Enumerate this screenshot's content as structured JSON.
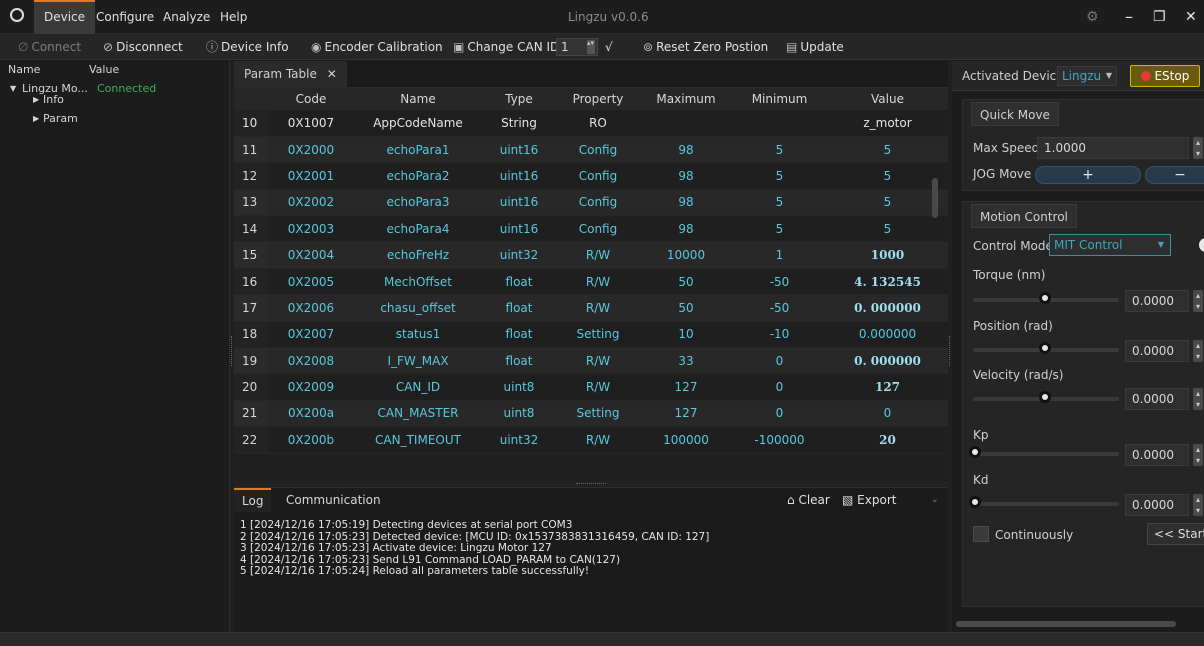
{
  "window": {
    "title": "Lingzu v0.0.6"
  },
  "menu": [
    "Device",
    "Configure",
    "Analyze",
    "Help"
  ],
  "toolbar": {
    "connect": "Connect",
    "disconnect": "Disconnect",
    "device_info": "Device Info",
    "encoder_calibration": "Encoder Calibration",
    "change_can_id": "Change CAN ID",
    "can_id_value": "1",
    "confirm": "√",
    "reset_zero": "Reset Zero Postion",
    "update": "Update"
  },
  "tree": {
    "headers": {
      "name": "Name",
      "value": "Value"
    },
    "device": {
      "name": "Lingzu Mo...",
      "value": "Connected"
    },
    "children": [
      "Info",
      "Param"
    ]
  },
  "param_tab": {
    "label": "Param Table",
    "close": "✕"
  },
  "table": {
    "columns": [
      "",
      "Code",
      "Name",
      "Type",
      "Property",
      "Maximum",
      "Minimum",
      "Value"
    ],
    "rows": [
      [
        "10",
        "0X1007",
        "AppCodeName",
        "String",
        "RO",
        "",
        "",
        "z_motor"
      ],
      [
        "11",
        "0X2000",
        "echoPara1",
        "uint16",
        "Config",
        "98",
        "5",
        "5"
      ],
      [
        "12",
        "0X2001",
        "echoPara2",
        "uint16",
        "Config",
        "98",
        "5",
        "5"
      ],
      [
        "13",
        "0X2002",
        "echoPara3",
        "uint16",
        "Config",
        "98",
        "5",
        "5"
      ],
      [
        "14",
        "0X2003",
        "echoPara4",
        "uint16",
        "Config",
        "98",
        "5",
        "5"
      ],
      [
        "15",
        "0X2004",
        "echoFreHz",
        "uint32",
        "R/W",
        "10000",
        "1",
        "1000"
      ],
      [
        "16",
        "0X2005",
        "MechOffset",
        "float",
        "R/W",
        "50",
        "-50",
        "4. 132545"
      ],
      [
        "17",
        "0X2006",
        "chasu_offset",
        "float",
        "R/W",
        "50",
        "-50",
        "0. 000000"
      ],
      [
        "18",
        "0X2007",
        "status1",
        "float",
        "Setting",
        "10",
        "-10",
        "0.000000"
      ],
      [
        "19",
        "0X2008",
        "I_FW_MAX",
        "float",
        "R/W",
        "33",
        "0",
        "0. 000000"
      ],
      [
        "20",
        "0X2009",
        "CAN_ID",
        "uint8",
        "R/W",
        "127",
        "0",
        "127"
      ],
      [
        "21",
        "0X200a",
        "CAN_MASTER",
        "uint8",
        "Setting",
        "127",
        "0",
        "0"
      ],
      [
        "22",
        "0X200b",
        "CAN_TIMEOUT",
        "uint32",
        "R/W",
        "100000",
        "-100000",
        "20"
      ]
    ]
  },
  "log": {
    "tabs": [
      "Log",
      "Communication"
    ],
    "clear": "Clear",
    "export": "Export",
    "lines": [
      "1 [2024/12/16 17:05:19] Detecting devices at serial port COM3",
      "2 [2024/12/16 17:05:23] Detected device: [MCU ID: 0x1537383831316459, CAN ID: 127]",
      "3 [2024/12/16 17:05:23] Activate device: Lingzu Motor 127",
      "4 [2024/12/16 17:05:23] Send L91 Command LOAD_PARAM to CAN(127)",
      "5 [2024/12/16 17:05:24] Reload all parameters table successfully!"
    ]
  },
  "right": {
    "activated_label": "Activated Device",
    "activated_value": "Lingzu",
    "estop": "EStop",
    "quick_move": "Quick Move",
    "max_speed_label": "Max Speed",
    "max_speed_value": "1.0000",
    "jog_label": "JOG Move",
    "jog_plus": "+",
    "jog_minus": "−",
    "motion_control": "Motion Control",
    "control_mode_label": "Control Mode",
    "control_mode_value": "MIT Control",
    "torque_label": "Torque (nm)",
    "torque_value": "0.0000",
    "position_label": "Position (rad)",
    "position_value": "0.0000",
    "velocity_label": "Velocity (rad/s)",
    "velocity_value": "0.0000",
    "kp_label": "Kp",
    "kp_value": "0.0000",
    "kd_label": "Kd",
    "kd_value": "0.0000",
    "continuously": "Continuously",
    "start": "<< Start"
  },
  "colors": {
    "accent": "#e07a1f",
    "cell_text": "#58c8dd",
    "connected": "#3fae5c",
    "estop": "#d9b400"
  },
  "sliders": {
    "torque": 0.5,
    "position": 0.5,
    "velocity": 0.5,
    "kp": 0.0,
    "kd": 0.0
  }
}
